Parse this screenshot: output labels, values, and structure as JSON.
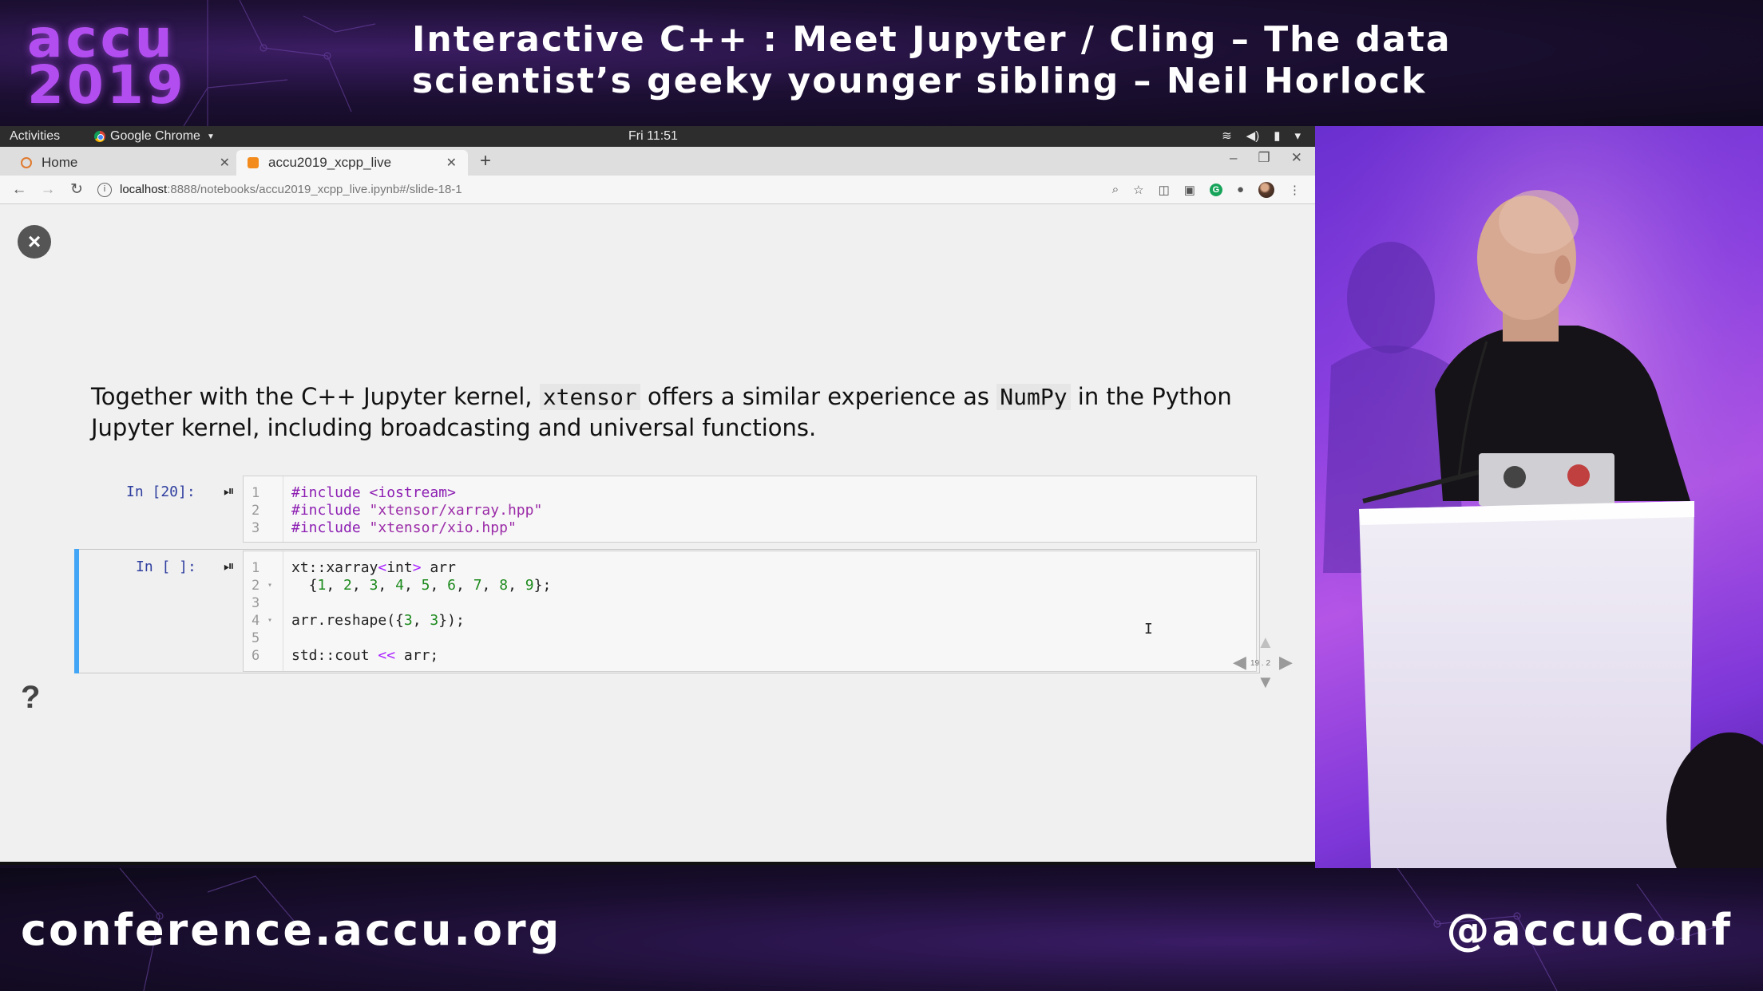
{
  "conference": {
    "logo_line1": "accu",
    "logo_line2": "2019",
    "title_line1": "Interactive C++ : Meet Jupyter / Cling – The data",
    "title_line2": "scientist’s geeky younger sibling – Neil Horlock",
    "url": "conference.accu.org",
    "handle": "@accuConf"
  },
  "desktop": {
    "activities": "Activities",
    "app_menu": "Google Chrome",
    "clock": "Fri 11:51"
  },
  "browser": {
    "tabs": [
      {
        "label": "Home",
        "active": false
      },
      {
        "label": "accu2019_xcpp_live",
        "active": true
      }
    ],
    "url_host": "localhost",
    "url_path": ":8888/notebooks/accu2019_xcpp_live.ipynb#/slide-18-1"
  },
  "slide": {
    "para_part1": "Together with the C++ Jupyter kernel, ",
    "para_code1": "xtensor",
    "para_part2": " offers a similar experience as ",
    "para_code2": "NumPy",
    "para_part3": " in the Python Jupyter kernel, including broadcasting and universal functions.",
    "cells": [
      {
        "prompt": "In [20]:",
        "lines": [
          {
            "n": "1",
            "fold": "",
            "tokens": [
              {
                "t": "#include <iostream>",
                "k": "pp"
              }
            ]
          },
          {
            "n": "2",
            "fold": "",
            "tokens": [
              {
                "t": "#include ",
                "k": "pp"
              },
              {
                "t": "\"xtensor/xarray.hpp\"",
                "k": "str"
              }
            ]
          },
          {
            "n": "3",
            "fold": "",
            "tokens": [
              {
                "t": "#include ",
                "k": "pp"
              },
              {
                "t": "\"xtensor/xio.hpp\"",
                "k": "str"
              }
            ]
          }
        ]
      },
      {
        "prompt": "In [ ]:",
        "lines": [
          {
            "n": "1",
            "fold": "",
            "tokens": [
              {
                "t": "xt::xarray",
                "k": ""
              },
              {
                "t": "<",
                "k": "op"
              },
              {
                "t": "int",
                "k": ""
              },
              {
                "t": ">",
                "k": "op"
              },
              {
                "t": " arr",
                "k": ""
              }
            ]
          },
          {
            "n": "2",
            "fold": "▾",
            "tokens": [
              {
                "t": "  {",
                "k": ""
              },
              {
                "t": "1",
                "k": "num"
              },
              {
                "t": ", ",
                "k": ""
              },
              {
                "t": "2",
                "k": "num"
              },
              {
                "t": ", ",
                "k": ""
              },
              {
                "t": "3",
                "k": "num"
              },
              {
                "t": ", ",
                "k": ""
              },
              {
                "t": "4",
                "k": "num"
              },
              {
                "t": ", ",
                "k": ""
              },
              {
                "t": "5",
                "k": "num"
              },
              {
                "t": ", ",
                "k": ""
              },
              {
                "t": "6",
                "k": "num"
              },
              {
                "t": ", ",
                "k": ""
              },
              {
                "t": "7",
                "k": "num"
              },
              {
                "t": ", ",
                "k": ""
              },
              {
                "t": "8",
                "k": "num"
              },
              {
                "t": ", ",
                "k": ""
              },
              {
                "t": "9",
                "k": "num"
              },
              {
                "t": "};",
                "k": ""
              }
            ]
          },
          {
            "n": "3",
            "fold": "",
            "tokens": []
          },
          {
            "n": "4",
            "fold": "▾",
            "tokens": [
              {
                "t": "arr.reshape({",
                "k": ""
              },
              {
                "t": "3",
                "k": "num"
              },
              {
                "t": ", ",
                "k": ""
              },
              {
                "t": "3",
                "k": "num"
              },
              {
                "t": "});",
                "k": ""
              }
            ]
          },
          {
            "n": "5",
            "fold": "",
            "tokens": []
          },
          {
            "n": "6",
            "fold": "",
            "tokens": [
              {
                "t": "std::cout ",
                "k": ""
              },
              {
                "t": "<<",
                "k": "op"
              },
              {
                "t": " arr;",
                "k": ""
              }
            ]
          }
        ]
      }
    ],
    "slide_number": "19 . 2"
  },
  "icons": {
    "close_slide": "×",
    "help": "?",
    "run": "⏯",
    "text_cursor": "I"
  }
}
